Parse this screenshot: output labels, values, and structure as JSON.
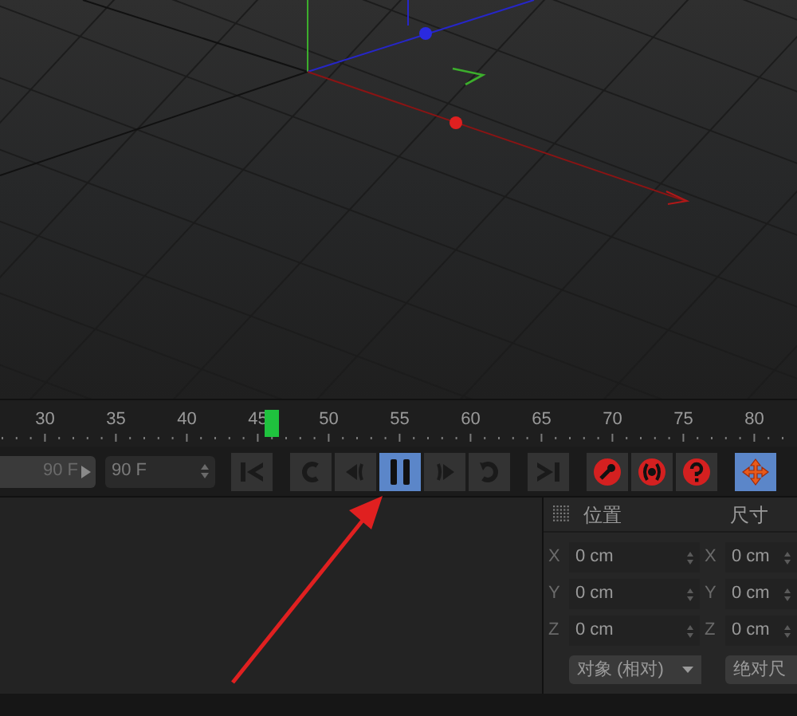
{
  "timeline": {
    "ticks": [
      "30",
      "35",
      "40",
      "45",
      "50",
      "55",
      "60",
      "65",
      "70",
      "75",
      "80"
    ],
    "playhead": {
      "level": 0.34
    }
  },
  "transport": {
    "frame_fields": [
      {
        "kind": "arrow",
        "value": "90 F"
      },
      {
        "kind": "spinner",
        "value": "90 F"
      }
    ],
    "button_groups": [
      [
        {
          "kind": "first",
          "selected": false
        }
      ],
      [
        {
          "kind": "loop-back",
          "selected": false
        },
        {
          "kind": "step-back",
          "selected": false
        },
        {
          "kind": "pause",
          "selected": true
        },
        {
          "kind": "step-forward",
          "selected": false
        },
        {
          "kind": "loop",
          "selected": false
        }
      ],
      [
        {
          "kind": "last",
          "selected": false
        }
      ],
      [
        {
          "kind": "record",
          "selected": false
        },
        {
          "kind": "auto-key",
          "selected": false
        },
        {
          "kind": "help",
          "selected": false
        }
      ],
      [
        {
          "kind": "move",
          "selected": true
        }
      ]
    ]
  },
  "coordinates": {
    "headers": [
      "位置",
      "尺寸"
    ],
    "rows": [
      {
        "axis": "X",
        "position": "0 cm",
        "size_axis": "X",
        "size": "0 cm"
      },
      {
        "axis": "Y",
        "position": "0 cm",
        "size_axis": "Y",
        "size": "0 cm"
      },
      {
        "axis": "Z",
        "position": "0 cm",
        "size_axis": "Z",
        "size": "0 cm"
      }
    ],
    "dropdowns": [
      {
        "label": "对象 (相对)",
        "kind": "caret"
      },
      {
        "label": "绝对尺",
        "kind": "plain"
      }
    ]
  }
}
